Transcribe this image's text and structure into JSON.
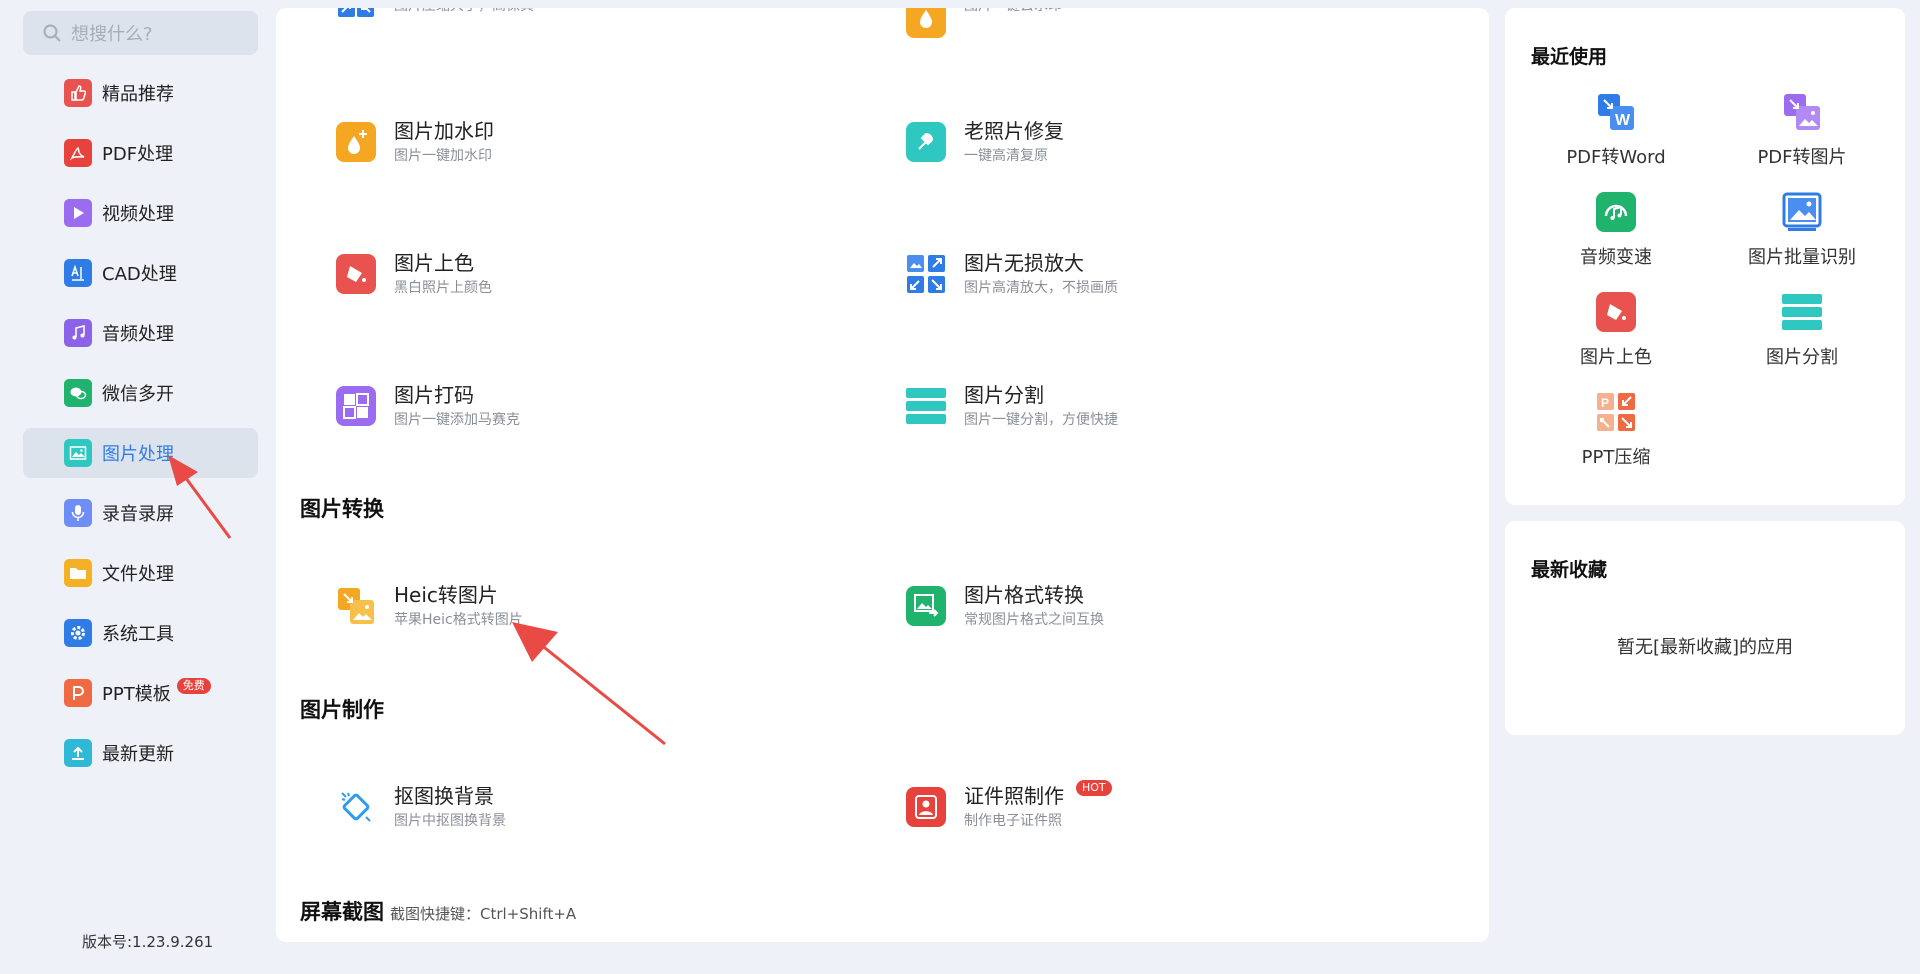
{
  "search": {
    "placeholder": "想搜什么?"
  },
  "sidebar": {
    "items": [
      {
        "label": "精品推荐",
        "icon": "thumbs-up-icon",
        "color": "#e8534f"
      },
      {
        "label": "PDF处理",
        "icon": "pdf-icon",
        "color": "#e8423d"
      },
      {
        "label": "视频处理",
        "icon": "play-icon",
        "color": "#9b6cf0"
      },
      {
        "label": "CAD处理",
        "icon": "cad-icon",
        "color": "#2f7ce6"
      },
      {
        "label": "音频处理",
        "icon": "music-note-icon",
        "color": "#8c63e8"
      },
      {
        "label": "微信多开",
        "icon": "wechat-icon",
        "color": "#1fb36d"
      },
      {
        "label": "图片处理",
        "icon": "image-icon",
        "color": "#2fc8c0"
      },
      {
        "label": "录音录屏",
        "icon": "microphone-icon",
        "color": "#6f8ef5"
      },
      {
        "label": "文件处理",
        "icon": "folder-icon",
        "color": "#f5b125"
      },
      {
        "label": "系统工具",
        "icon": "gear-icon",
        "color": "#2f7ce6"
      },
      {
        "label": "PPT模板",
        "icon": "ppt-icon",
        "color": "#ef6a43",
        "badge": "免费"
      },
      {
        "label": "最新更新",
        "icon": "upload-icon",
        "color": "#2fb9d6"
      }
    ],
    "active_index": 6,
    "version": "版本号:1.23.9.261"
  },
  "main": {
    "partial_tools": [
      {
        "name": "",
        "desc": "图片压缩大小，高保真",
        "icon": "compress-icon",
        "color": "#2f7ce6"
      },
      {
        "name": "",
        "desc": "图片一键去水印",
        "icon": "watermark-remove-icon",
        "color": "#f5a623"
      }
    ],
    "tools": [
      {
        "name": "图片加水印",
        "desc": "图片一键加水印",
        "icon": "watermark-add-icon",
        "color": "#f5a623"
      },
      {
        "name": "老照片修复",
        "desc": "一键高清复原",
        "icon": "photo-restore-icon",
        "color": "#2fc8c0"
      },
      {
        "name": "图片上色",
        "desc": "黑白照片上颜色",
        "icon": "paint-bucket-icon",
        "color": "#e8534f"
      },
      {
        "name": "图片无损放大",
        "desc": "图片高清放大，不损画质",
        "icon": "enlarge-icon",
        "color": "#2f7ce6"
      },
      {
        "name": "图片打码",
        "desc": "图片一键添加马赛克",
        "icon": "mosaic-icon",
        "color": "#9b6cf0"
      },
      {
        "name": "图片分割",
        "desc": "图片一键分割，方便快捷",
        "icon": "split-icon",
        "color": "#2fc8c0"
      }
    ],
    "section_convert": {
      "title": "图片转换"
    },
    "convert_tools": [
      {
        "name": "Heic转图片",
        "desc": "苹果Heic格式转图片",
        "icon": "heic-icon",
        "color": "#f5a623"
      },
      {
        "name": "图片格式转换",
        "desc": "常规图片格式之间互换",
        "icon": "format-convert-icon",
        "color": "#1fb36d"
      }
    ],
    "section_make": {
      "title": "图片制作"
    },
    "make_tools": [
      {
        "name": "抠图换背景",
        "desc": "图片中抠图换背景",
        "icon": "cutout-icon",
        "color": "#2f9cf0"
      },
      {
        "name": "证件照制作",
        "desc": "制作电子证件照",
        "icon": "id-photo-icon",
        "color": "#e8423d",
        "badge": "HOT"
      }
    ],
    "section_screenshot": {
      "title": "屏幕截图",
      "sub": "截图快捷键：Ctrl+Shift+A"
    }
  },
  "recent": {
    "title": "最近使用",
    "items": [
      {
        "label": "PDF转Word",
        "icon": "pdf-to-word-icon",
        "color": "#2f7ce6"
      },
      {
        "label": "PDF转图片",
        "icon": "pdf-to-image-icon",
        "color": "#9b6cf0"
      },
      {
        "label": "音频变速",
        "icon": "audio-speed-icon",
        "color": "#1fb36d"
      },
      {
        "label": "图片批量识别",
        "icon": "image-recognize-icon",
        "color": "#2f7ce6"
      },
      {
        "label": "图片上色",
        "icon": "paint-bucket-icon",
        "color": "#e8534f"
      },
      {
        "label": "图片分割",
        "icon": "split-icon",
        "color": "#2fc8c0"
      },
      {
        "label": "PPT压缩",
        "icon": "ppt-compress-icon",
        "color": "#ef6a43"
      }
    ]
  },
  "favorites": {
    "title": "最新收藏",
    "empty_text": "暂无[最新收藏]的应用"
  }
}
